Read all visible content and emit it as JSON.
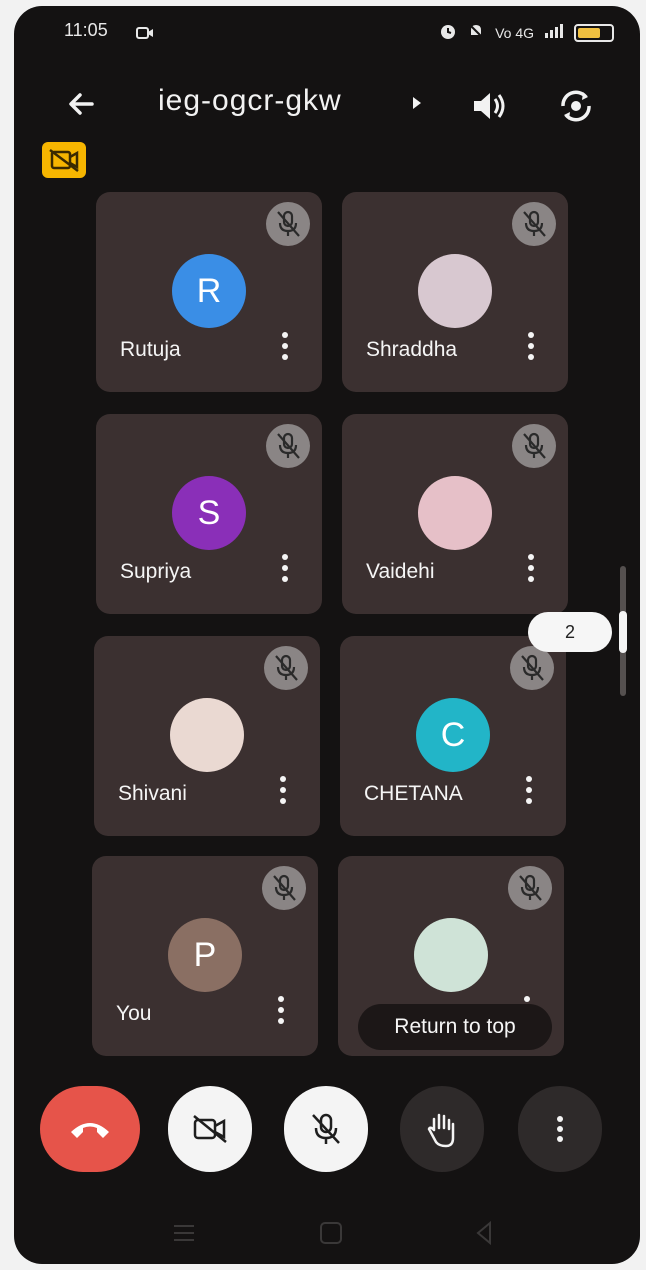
{
  "status_bar": {
    "time": "11:05",
    "network_text": "Vo 4G",
    "icons": [
      "video-recording-icon",
      "alarm-icon",
      "mute-icon",
      "signal-icon",
      "battery-icon"
    ]
  },
  "header": {
    "title": "ieg-ogcr-gkw",
    "icons": [
      "back-arrow-icon",
      "chevron-right-icon",
      "speaker-icon",
      "switch-camera-icon"
    ]
  },
  "badge_icon": "no-video-recording-icon",
  "participants": [
    {
      "name": "Rutuja",
      "initial": "R",
      "avatar_color": "#3a8ee6"
    },
    {
      "name": "Shraddha",
      "initial": "",
      "avatar_color": "#d8c8d0"
    },
    {
      "name": "Supriya",
      "initial": "S",
      "avatar_color": "#8a2fb8"
    },
    {
      "name": "Vaidehi",
      "initial": "",
      "avatar_color": "#e6c0c8"
    },
    {
      "name": "Shivani",
      "initial": "",
      "avatar_color": "#ead9d2"
    },
    {
      "name": "CHETANA",
      "initial": "C",
      "avatar_color": "#22b5c8"
    },
    {
      "name": "You",
      "initial": "P",
      "avatar_color": "#8a6f63"
    },
    {
      "name": "",
      "initial": "",
      "avatar_color": "#cfe3d7"
    }
  ],
  "pager": {
    "current": "2"
  },
  "return_to_top": "Return to top",
  "controls": {
    "end_call_color": "#e6544a",
    "labels": [
      "end-call",
      "camera-off",
      "mic-off",
      "raise-hand",
      "more-options"
    ]
  }
}
